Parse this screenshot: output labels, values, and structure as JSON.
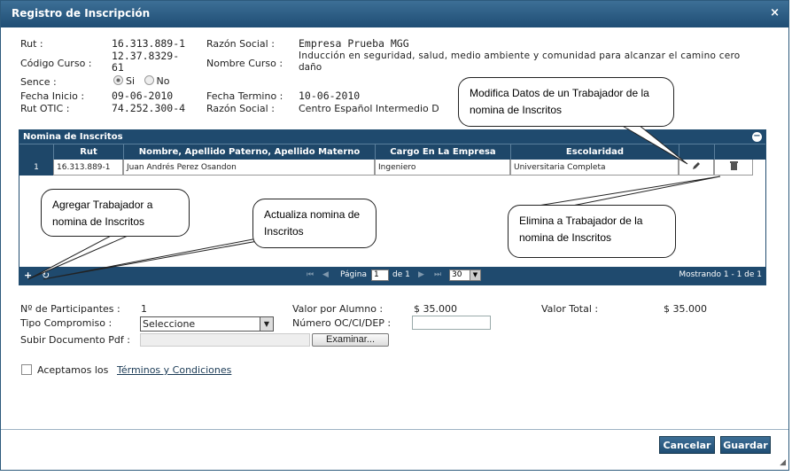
{
  "dialog": {
    "title": "Registro de Inscripción",
    "close": "×"
  },
  "info": {
    "rut_label": "Rut :",
    "rut_value": "16.313.889-1",
    "razon_label": "Razón Social :",
    "razon_value": "Empresa Prueba MGG",
    "codigo_label": "Código Curso :",
    "codigo_value_1": "12.37.8329-",
    "codigo_value_2": "61",
    "nombre_curso_label": "Nombre Curso :",
    "nombre_curso_value_1": "Inducción en seguridad, salud, medio ambiente y comunidad para alcanzar el camino cero",
    "nombre_curso_value_2": "daño",
    "sence_label": "Sence :",
    "sence_si": "Si",
    "sence_no": "No",
    "sence_selected": "Si",
    "fecha_inicio_label": "Fecha Inicio :",
    "fecha_inicio_value": "09-06-2010",
    "fecha_termino_label": "Fecha Termino :",
    "fecha_termino_value": "10-06-2010",
    "rut_otic_label": "Rut OTIC :",
    "rut_otic_value": "74.252.300-4",
    "razon2_label": "Razón Social :",
    "razon2_value": "Centro Español Intermedio D"
  },
  "grid": {
    "title": "Nomina de Inscritos",
    "columns": [
      "Rut",
      "Nombre, Apellido Paterno, Apellido Materno",
      "Cargo En La Empresa",
      "Escolaridad"
    ],
    "rows": [
      {
        "num": "1",
        "rut": "16.313.889-1",
        "nombre": "Juan Andrés Perez Osandon",
        "cargo": "Ingeniero",
        "escolaridad": "Universitaria Completa"
      }
    ],
    "pager": {
      "page_label": "Página",
      "page_value": "1",
      "of_label": "de 1",
      "page_size": "30",
      "showing": "Mostrando 1 - 1 de 1"
    }
  },
  "callouts": {
    "modifica": "Modifica Datos de un Trabajador de la nomina de Inscritos",
    "agregar": "Agregar Trabajador a nomina de Inscritos",
    "actualiza": "Actualiza nomina de Inscritos",
    "elimina": "Elimina a Trabajador de la nomina de Inscritos"
  },
  "form": {
    "participantes_label": "Nº de Participantes :",
    "participantes_value": "1",
    "valor_alumno_label": "Valor por Alumno :",
    "valor_alumno_value": "$ 35.000",
    "valor_total_label": "Valor Total :",
    "valor_total_value": "$ 35.000",
    "tipo_label": "Tipo Compromiso :",
    "tipo_value": "Seleccione",
    "numero_label": "Número OC/CI/DEP :",
    "numero_value": "",
    "subir_label": "Subir Documento Pdf :",
    "examinar": "Examinar...",
    "aceptamos": "Aceptamos los",
    "terminos": "Términos y Condiciones"
  },
  "buttons": {
    "cancelar": "Cancelar",
    "guardar": "Guardar"
  },
  "colors": {
    "header": "#1f4a6e",
    "accent": "#3d6f96"
  }
}
